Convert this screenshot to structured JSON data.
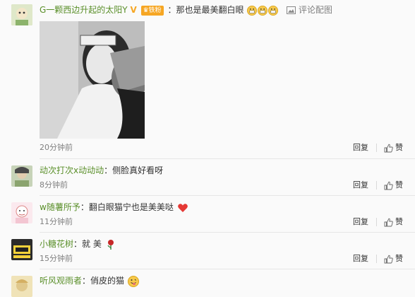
{
  "comments": [
    {
      "username": "G一颗西边升起的太阳Y",
      "badge": "铁粉",
      "text": "：那也是最美翻白眼",
      "action": "评论配图",
      "time": "20分钟前",
      "reply": "回复",
      "like": "赞"
    },
    {
      "username": "动次打次x动动动",
      "text": "：侧脸真好看呀",
      "time": "8分钟前",
      "reply": "回复",
      "like": "赞"
    },
    {
      "username": "w随薯所予",
      "text": "：翻白眼猫宁也是美美哒",
      "time": "11分钟前",
      "reply": "回复",
      "like": "赞"
    },
    {
      "username": "小糖花树",
      "text": "：就 美",
      "time": "15分钟前",
      "reply": "回复",
      "like": "赞"
    },
    {
      "username": "听风观雨者",
      "text": "：俏皮的猫",
      "time": "",
      "reply": "",
      "like": ""
    }
  ],
  "colors": {
    "username": "#5a8f29",
    "time": "#808080",
    "badge": "#f6a623"
  }
}
